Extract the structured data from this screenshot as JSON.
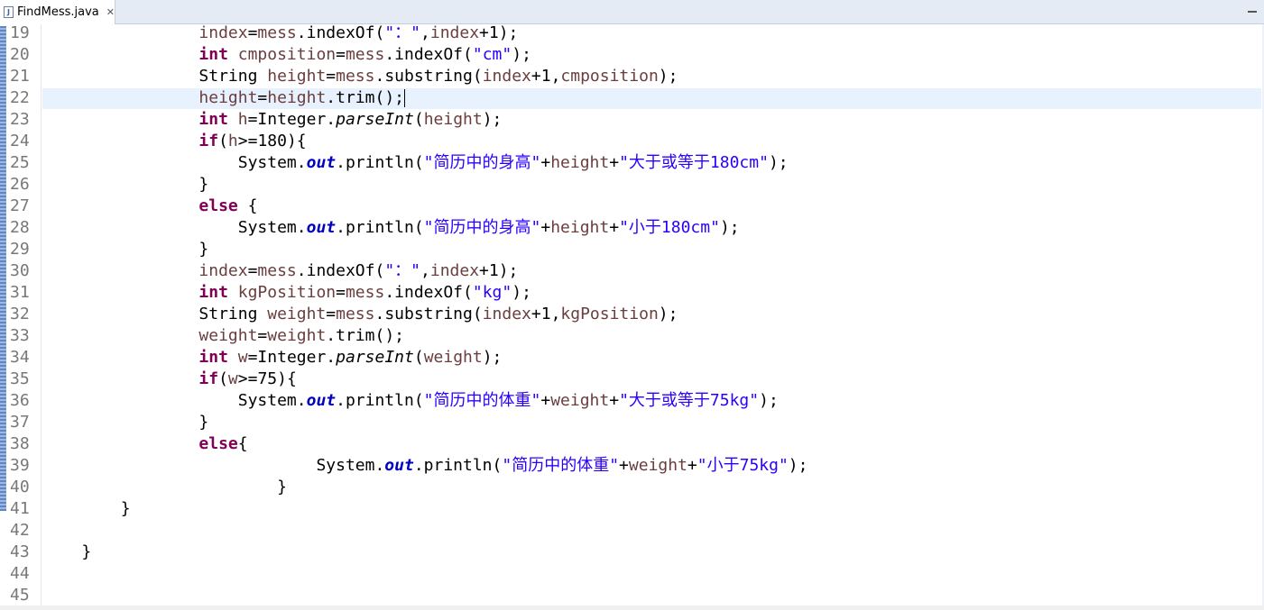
{
  "tab": {
    "title": "FindMess.java",
    "close": "✕"
  },
  "lines": [
    {
      "n": "19",
      "indent": "                ",
      "tokens": [
        [
          "var",
          "index"
        ],
        [
          "",
          "="
        ],
        [
          "var",
          "mess"
        ],
        [
          "",
          ".indexOf("
        ],
        [
          "str",
          "\"："
        ],
        [
          "str",
          "\""
        ],
        [
          "",
          ","
        ],
        [
          "var",
          "index"
        ],
        [
          "",
          "+1);"
        ]
      ]
    },
    {
      "n": "20",
      "indent": "                ",
      "tokens": [
        [
          "kw",
          "int"
        ],
        [
          "",
          " "
        ],
        [
          "var",
          "cmposition"
        ],
        [
          "",
          "="
        ],
        [
          "var",
          "mess"
        ],
        [
          "",
          ".indexOf("
        ],
        [
          "str",
          "\"cm\""
        ],
        [
          "",
          ");"
        ]
      ]
    },
    {
      "n": "21",
      "indent": "                ",
      "tokens": [
        [
          "",
          "String "
        ],
        [
          "var",
          "height"
        ],
        [
          "",
          "="
        ],
        [
          "var",
          "mess"
        ],
        [
          "",
          ".substring("
        ],
        [
          "var",
          "index"
        ],
        [
          "",
          "+1,"
        ],
        [
          "var",
          "cmposition"
        ],
        [
          "",
          ");"
        ]
      ]
    },
    {
      "n": "22",
      "indent": "                ",
      "tokens": [
        [
          "var",
          "height"
        ],
        [
          "",
          "="
        ],
        [
          "var",
          "height"
        ],
        [
          "",
          ".trim();"
        ]
      ],
      "current": true
    },
    {
      "n": "23",
      "indent": "                ",
      "tokens": [
        [
          "kw",
          "int"
        ],
        [
          "",
          " "
        ],
        [
          "var",
          "h"
        ],
        [
          "",
          "=Integer."
        ],
        [
          "meth",
          "parseInt"
        ],
        [
          "",
          "("
        ],
        [
          "var",
          "height"
        ],
        [
          "",
          ");"
        ]
      ]
    },
    {
      "n": "24",
      "indent": "                ",
      "tokens": [
        [
          "kw",
          "if"
        ],
        [
          "",
          "("
        ],
        [
          "var",
          "h"
        ],
        [
          "",
          ">=180){"
        ]
      ]
    },
    {
      "n": "25",
      "indent": "                    ",
      "tokens": [
        [
          "",
          "System."
        ],
        [
          "stat",
          "out"
        ],
        [
          "",
          ".println("
        ],
        [
          "str",
          "\"简历中的身高\""
        ],
        [
          "",
          "+"
        ],
        [
          "var",
          "height"
        ],
        [
          "",
          "+"
        ],
        [
          "str",
          "\"大于或等于180cm\""
        ],
        [
          "",
          ");"
        ]
      ]
    },
    {
      "n": "26",
      "indent": "                ",
      "tokens": [
        [
          "",
          "}"
        ]
      ]
    },
    {
      "n": "27",
      "indent": "                ",
      "tokens": [
        [
          "kw",
          "else"
        ],
        [
          "",
          " {"
        ]
      ]
    },
    {
      "n": "28",
      "indent": "                    ",
      "tokens": [
        [
          "",
          "System."
        ],
        [
          "stat",
          "out"
        ],
        [
          "",
          ".println("
        ],
        [
          "str",
          "\"简历中的身高\""
        ],
        [
          "",
          "+"
        ],
        [
          "var",
          "height"
        ],
        [
          "",
          "+"
        ],
        [
          "str",
          "\"小于180cm\""
        ],
        [
          "",
          ");"
        ]
      ]
    },
    {
      "n": "29",
      "indent": "                ",
      "tokens": [
        [
          "",
          "}"
        ]
      ]
    },
    {
      "n": "30",
      "indent": "                ",
      "tokens": [
        [
          "var",
          "index"
        ],
        [
          "",
          "="
        ],
        [
          "var",
          "mess"
        ],
        [
          "",
          ".indexOf("
        ],
        [
          "str",
          "\"："
        ],
        [
          "str",
          "\""
        ],
        [
          "",
          ","
        ],
        [
          "var",
          "index"
        ],
        [
          "",
          "+1);"
        ]
      ]
    },
    {
      "n": "31",
      "indent": "                ",
      "tokens": [
        [
          "kw",
          "int"
        ],
        [
          "",
          " "
        ],
        [
          "var",
          "kgPosition"
        ],
        [
          "",
          "="
        ],
        [
          "var",
          "mess"
        ],
        [
          "",
          ".indexOf("
        ],
        [
          "str",
          "\"kg\""
        ],
        [
          "",
          ");"
        ]
      ]
    },
    {
      "n": "32",
      "indent": "                ",
      "tokens": [
        [
          "",
          "String "
        ],
        [
          "var",
          "weight"
        ],
        [
          "",
          "="
        ],
        [
          "var",
          "mess"
        ],
        [
          "",
          ".substring("
        ],
        [
          "var",
          "index"
        ],
        [
          "",
          "+1,"
        ],
        [
          "var",
          "kgPosition"
        ],
        [
          "",
          ");"
        ]
      ]
    },
    {
      "n": "33",
      "indent": "                ",
      "tokens": [
        [
          "var",
          "weight"
        ],
        [
          "",
          "="
        ],
        [
          "var",
          "weight"
        ],
        [
          "",
          ".trim();"
        ]
      ]
    },
    {
      "n": "34",
      "indent": "                ",
      "tokens": [
        [
          "kw",
          "int"
        ],
        [
          "",
          " "
        ],
        [
          "var",
          "w"
        ],
        [
          "",
          "=Integer."
        ],
        [
          "meth",
          "parseInt"
        ],
        [
          "",
          "("
        ],
        [
          "var",
          "weight"
        ],
        [
          "",
          ");"
        ]
      ]
    },
    {
      "n": "35",
      "indent": "                ",
      "tokens": [
        [
          "kw",
          "if"
        ],
        [
          "",
          "("
        ],
        [
          "var",
          "w"
        ],
        [
          "",
          ">=75){"
        ]
      ]
    },
    {
      "n": "36",
      "indent": "                    ",
      "tokens": [
        [
          "",
          "System."
        ],
        [
          "stat",
          "out"
        ],
        [
          "",
          ".println("
        ],
        [
          "str",
          "\"简历中的体重\""
        ],
        [
          "",
          "+"
        ],
        [
          "var",
          "weight"
        ],
        [
          "",
          "+"
        ],
        [
          "str",
          "\"大于或等于75kg\""
        ],
        [
          "",
          ");"
        ]
      ]
    },
    {
      "n": "37",
      "indent": "                ",
      "tokens": [
        [
          "",
          "}"
        ]
      ]
    },
    {
      "n": "38",
      "indent": "                ",
      "tokens": [
        [
          "kw",
          "else"
        ],
        [
          "",
          "{"
        ]
      ]
    },
    {
      "n": "39",
      "indent": "                            ",
      "tokens": [
        [
          "",
          "System."
        ],
        [
          "stat",
          "out"
        ],
        [
          "",
          ".println("
        ],
        [
          "str",
          "\"简历中的体重\""
        ],
        [
          "",
          "+"
        ],
        [
          "var",
          "weight"
        ],
        [
          "",
          "+"
        ],
        [
          "str",
          "\"小于75kg\""
        ],
        [
          "",
          ");"
        ]
      ]
    },
    {
      "n": "40",
      "indent": "                        ",
      "tokens": [
        [
          "",
          "}"
        ]
      ]
    },
    {
      "n": "41",
      "indent": "        ",
      "tokens": [
        [
          "",
          "}"
        ]
      ]
    },
    {
      "n": "42",
      "indent": "",
      "tokens": []
    },
    {
      "n": "43",
      "indent": "    ",
      "tokens": [
        [
          "",
          "}"
        ]
      ]
    },
    {
      "n": "44",
      "indent": "",
      "tokens": []
    },
    {
      "n": "45",
      "indent": "",
      "tokens": []
    }
  ]
}
